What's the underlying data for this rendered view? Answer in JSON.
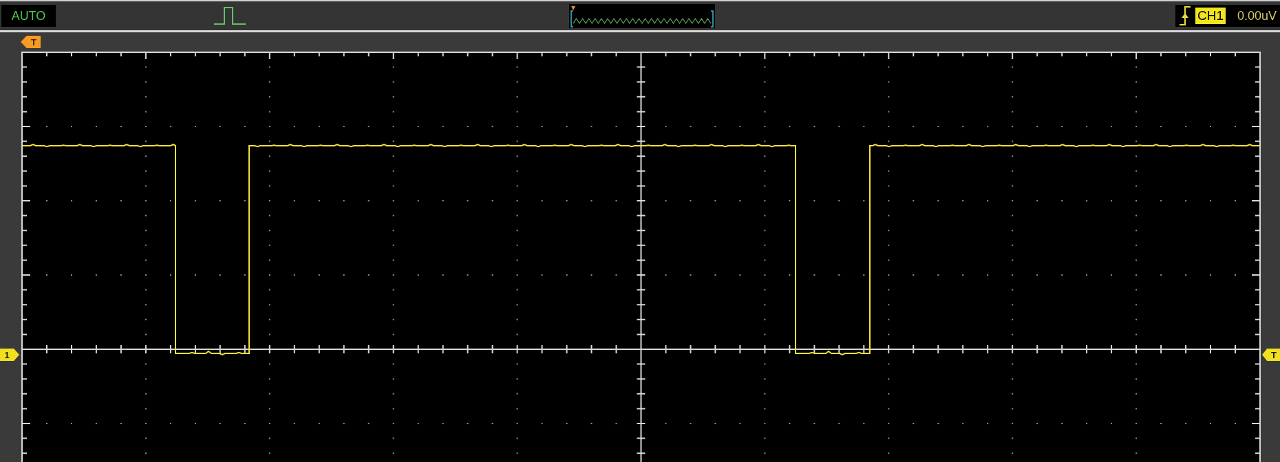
{
  "top_bar": {
    "mode": "AUTO",
    "trigger_source": "CH1",
    "trigger_level": "0.00uV"
  },
  "markers": [
    {
      "kind": "position",
      "label": "T"
    },
    {
      "kind": "channel",
      "label": "1"
    },
    {
      "kind": "level",
      "label": "T"
    }
  ]
}
